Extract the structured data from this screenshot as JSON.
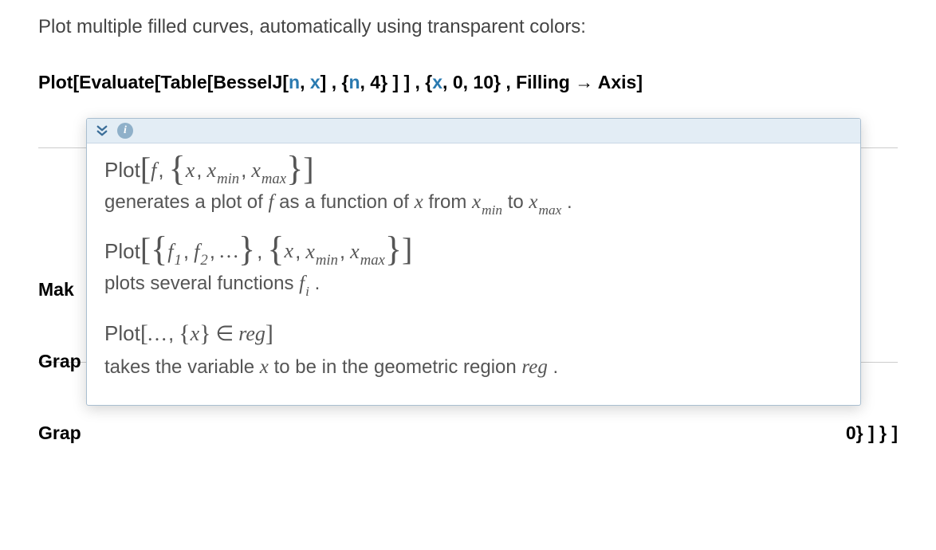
{
  "intro": "Plot multiple filled curves, automatically using transparent colors:",
  "code": {
    "p1": "Plot[Evaluate[Table[BesselJ[",
    "n": "n",
    "p2": ", ",
    "x": "x",
    "p3": "] , {",
    "n2": "n",
    "p4": ", 4} ] ] , {",
    "x2": "x",
    "p5": ", 0, 10} , Filling → Axis]"
  },
  "background": {
    "mak": "Mak",
    "grap1": "Grap",
    "grap2": "Grap",
    "trail": "0} ] } ]"
  },
  "popover": {
    "entries": [
      {
        "fn": "Plot",
        "sig_parts": {
          "f": "f",
          "x": "x",
          "xmin_base": "x",
          "xmin_sub": "min",
          "xmax_base": "x",
          "xmax_sub": "max"
        },
        "desc": {
          "t1": "generates a plot of ",
          "f": "f",
          "t2": " as a function of ",
          "x": "x",
          "t3": " from ",
          "xmin_base": "x",
          "xmin_sub": "min",
          "t4": " to ",
          "xmax_base": "x",
          "xmax_sub": "max",
          "t5": " ."
        }
      },
      {
        "fn": "Plot",
        "sig_parts": {
          "f1_base": "f",
          "f1_sub": "1",
          "f2_base": "f",
          "f2_sub": "2",
          "dots": "…",
          "x": "x",
          "xmin_base": "x",
          "xmin_sub": "min",
          "xmax_base": "x",
          "xmax_sub": "max"
        },
        "desc": {
          "t1": "plots several functions ",
          "fi_base": "f",
          "fi_sub": "i",
          "t2": " ."
        }
      },
      {
        "fn": "Plot",
        "sig_parts": {
          "dots": "…",
          "x": "x",
          "reg": "reg"
        },
        "desc": {
          "t1": "takes the variable ",
          "x": "x",
          "t2": " to be in the geometric region ",
          "reg": "reg",
          "t3": " ."
        }
      }
    ]
  }
}
